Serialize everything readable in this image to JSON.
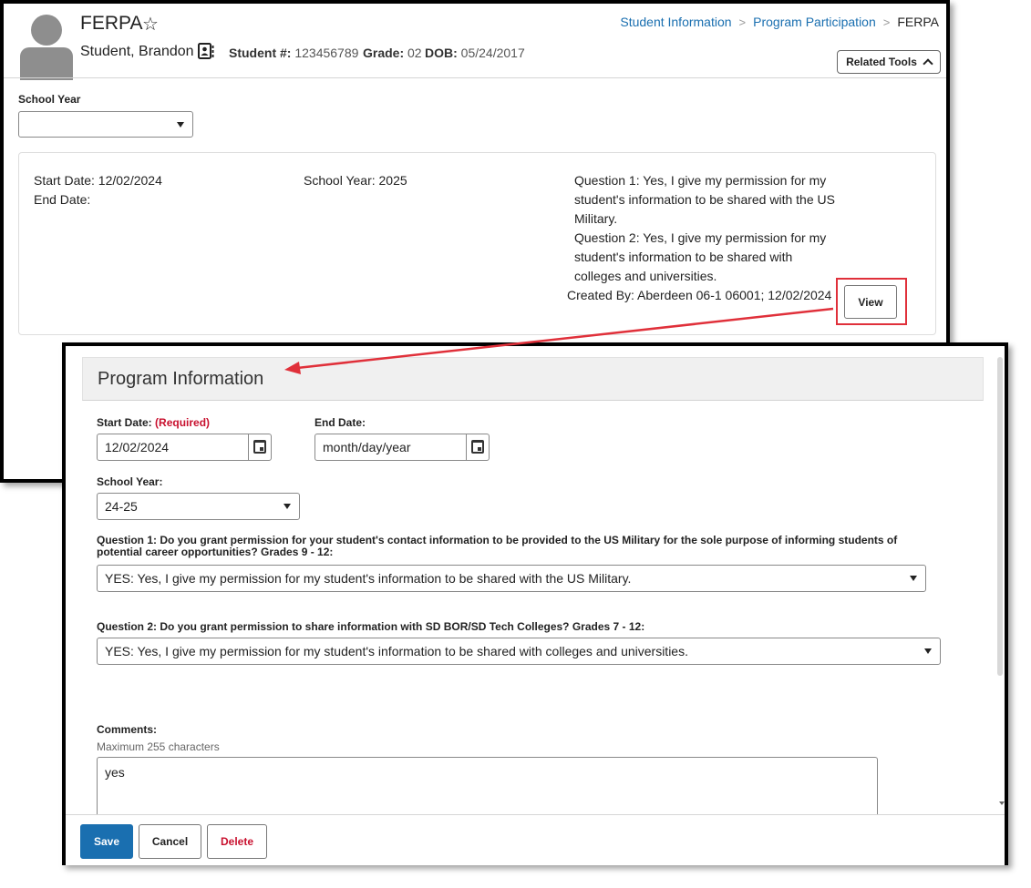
{
  "header": {
    "page_title": "FERPA",
    "student_name": "Student, Brandon",
    "student_number_label": "Student #:",
    "student_number": "123456789",
    "grade_label": "Grade:",
    "grade": "02",
    "dob_label": "DOB:",
    "dob": "05/24/2017",
    "related_tools_label": "Related Tools"
  },
  "breadcrumb": {
    "items": [
      "Student Information",
      "Program Participation",
      "FERPA"
    ]
  },
  "filter": {
    "school_year_label": "School Year",
    "school_year_value": ""
  },
  "record": {
    "start_date": "Start Date: 12/02/2024",
    "end_date": "End Date:",
    "school_year": "School Year: 2025",
    "question1": "Question 1: Yes, I give my permission for my student's information to be shared with the US Military.",
    "question2": "Question 2: Yes, I give my permission for my student's information to be shared with colleges and universities.",
    "created_by": "Created By: Aberdeen 06-1 06001; 12/02/2024",
    "view_label": "View"
  },
  "form": {
    "title": "Program Information",
    "start_date_label": "Start Date:",
    "required_label": "(Required)",
    "start_date_value": "12/02/2024",
    "end_date_label": "End Date:",
    "end_date_placeholder": "month/day/year",
    "school_year_label": "School Year:",
    "school_year_value": "24-25",
    "question1_label": "Question 1: Do you grant permission for your student's contact information to be provided to the US Military for the sole purpose of informing students of potential career opportunities? Grades 9 - 12:",
    "question1_value": "YES: Yes, I give my permission for my student's information to be shared with the US Military.",
    "question2_label": "Question 2: Do you grant permission to share information with SD BOR/SD Tech Colleges? Grades 7 - 12:",
    "question2_value": "YES: Yes, I give my permission for my student's information to be shared with colleges and universities.",
    "comments_label": "Comments:",
    "comments_hint": "Maximum 255 characters",
    "comments_value": "yes"
  },
  "actions": {
    "save": "Save",
    "cancel": "Cancel",
    "delete": "Delete"
  },
  "colors": {
    "link": "#1a6fb0",
    "primary_button": "#1a6fb0",
    "required": "#c8102e",
    "annotation": "#e0303a"
  }
}
